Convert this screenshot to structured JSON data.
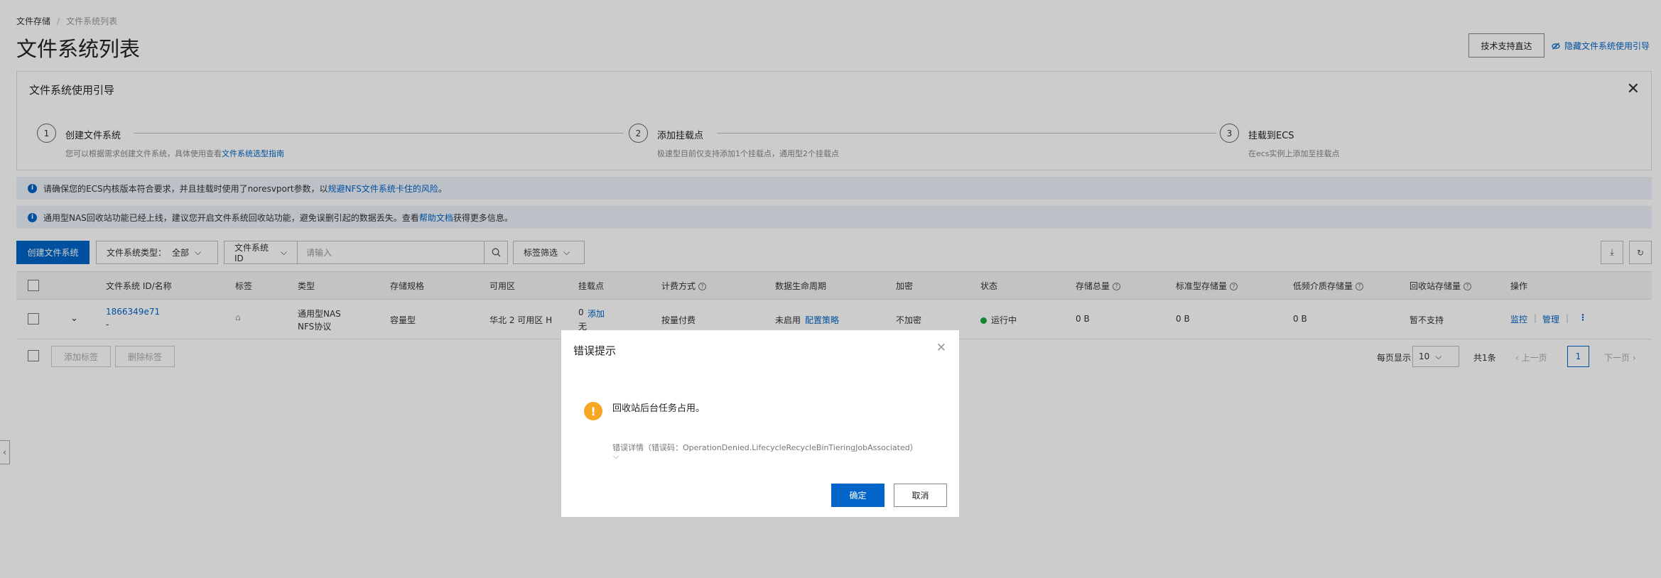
{
  "breadcrumb": {
    "root": "文件存储",
    "current": "文件系统列表"
  },
  "page_title": "文件系统列表",
  "header": {
    "tech_support": "技术支持直达",
    "hide_guide": "隐藏文件系统使用引导"
  },
  "guide": {
    "title": "文件系统使用引导",
    "steps": [
      {
        "num": "1",
        "title": "创建文件系统",
        "desc_prefix": "您可以根据需求创建文件系统，具体使用查看",
        "desc_link": "文件系统选型指南"
      },
      {
        "num": "2",
        "title": "添加挂载点",
        "desc": "极速型目前仅支持添加1个挂载点，通用型2个挂载点"
      },
      {
        "num": "3",
        "title": "挂载到ECS",
        "desc": "在ecs实例上添加至挂载点"
      }
    ]
  },
  "notices": [
    {
      "text": "请确保您的ECS内核版本符合要求，并且挂载时使用了noresvport参数，以",
      "link": "规避NFS文件系统卡住的风险",
      "suffix": "。"
    },
    {
      "text": "通用型NAS回收站功能已经上线，建议您开启文件系统回收站功能，避免误删引起的数据丢失。查看",
      "link": "帮助文档",
      "suffix": "获得更多信息。"
    }
  ],
  "toolbar": {
    "create_btn": "创建文件系统",
    "type_filter_label": "文件系统类型：",
    "type_filter_value": "全部",
    "id_filter": "文件系统ID",
    "search_placeholder": "请输入",
    "tag_filter": "标签筛选"
  },
  "table": {
    "headers": [
      "文件系统 ID/名称",
      "标签",
      "类型",
      "存储规格",
      "可用区",
      "挂载点",
      "计费方式",
      "数据生命周期",
      "加密",
      "状态",
      "存储总量",
      "标准型存储量",
      "低频介质存储量",
      "回收站存储量",
      "操作"
    ],
    "row": {
      "id": "1866349e71",
      "name": "-",
      "type_line1": "通用型NAS",
      "type_line2": "NFS协议",
      "spec": "容量型",
      "zone": "华北 2 可用区 H",
      "mount_count": "0",
      "mount_add": "添加",
      "mount_line2": "无",
      "billing": "按量付费",
      "lifecycle": "未启用",
      "lifecycle_link": "配置策略",
      "encrypt": "不加密",
      "status": "运行中",
      "total": "0 B",
      "standard": "0 B",
      "infrequent": "0 B",
      "recycle": "暂不支持",
      "op_monitor": "监控",
      "op_manage": "管理",
      "op_more": "⋮"
    }
  },
  "footer": {
    "add_tag": "添加标签",
    "remove_tag": "删除标签",
    "per_page_label": "每页显示",
    "per_page_value": "10",
    "total": "共1条",
    "prev": "上一页",
    "page": "1",
    "next": "下一页"
  },
  "dialog": {
    "title": "错误提示",
    "message": "回收站后台任务占用。",
    "detail": "错误详情（错误码：OperationDenied.LifecycleRecycleBinTieringJobAssociated）",
    "ok": "确定",
    "cancel": "取消"
  },
  "colors": {
    "primary": "#0064c8",
    "status_green": "#1ca53a",
    "warning": "#f5a623"
  }
}
